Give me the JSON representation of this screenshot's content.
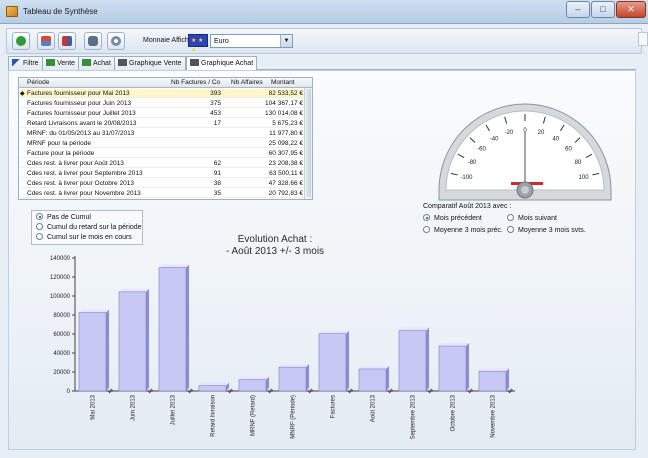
{
  "window": {
    "title": "Tableau de Synthèse",
    "min": "–",
    "max": "□",
    "close": "✕"
  },
  "toolbar": {
    "buttons": [
      "ok-icon",
      "calculator-icon",
      "export-icon",
      "print-icon",
      "tools-icon"
    ],
    "monnaie_label": "Monnaie Affichée",
    "currency_value": "Euro",
    "flag_stars": "★ ★ ★"
  },
  "tabs": [
    {
      "label": "Filtre",
      "icon": "filter-icon"
    },
    {
      "label": "Vente",
      "icon": "sales-icon"
    },
    {
      "label": "Achat",
      "icon": "purchase-icon"
    },
    {
      "label": "Graphique Vente",
      "icon": "chart-icon"
    },
    {
      "label": "Graphique Achat",
      "icon": "chart-icon",
      "active": true
    }
  ],
  "grid": {
    "headers": [
      "Période",
      "Nb Factures / Co",
      "Nb Affaires",
      "Montant"
    ],
    "rows": [
      {
        "periode": "Factures fournisseur pour Mai 2013",
        "nb": "393",
        "montant": "82 533,52 €",
        "selected": true
      },
      {
        "periode": "Factures fournisseur pour Juin 2013",
        "nb": "375",
        "montant": "104 367,17 €"
      },
      {
        "periode": "Factures fournisseur pour Juillet 2013",
        "nb": "453",
        "montant": "130 014,08 €"
      },
      {
        "periode": "Retard Livraisons avant le 20/08/2013",
        "nb": "17",
        "montant": "5 675,23 €"
      },
      {
        "periode": "MRNF: du 01/05/2013 au 31/07/2013",
        "nb": "",
        "montant": "11 977,80 €"
      },
      {
        "periode": "MRNF pour la période",
        "nb": "",
        "montant": "25 098,22 €"
      },
      {
        "periode": "Facture pour la période",
        "nb": "",
        "montant": "60 307,95 €"
      },
      {
        "periode": "Cdes rest. à livrer pour Août 2013",
        "nb": "62",
        "montant": "23 208,38 €"
      },
      {
        "periode": "Cdes rest. à livrer pour Septembre 2013",
        "nb": "91",
        "montant": "63 500,11 €"
      },
      {
        "periode": "Cdes rest. à livrer pour Octobre 2013",
        "nb": "38",
        "montant": "47 328,66 €"
      },
      {
        "periode": "Cdes rest. à livrer pour Novembre 2013",
        "nb": "35",
        "montant": "20 792,83 €"
      }
    ]
  },
  "gauge": {
    "ticks": [
      "-100",
      "-80",
      "-60",
      "-40",
      "-20",
      "0",
      "20",
      "40",
      "60",
      "80",
      "100"
    ],
    "needle_value": 0
  },
  "comparatif": {
    "label": "Comparatif Août 2013  avec :",
    "options": [
      {
        "label": "Mois précédent",
        "checked": true
      },
      {
        "label": "Mois suivant",
        "checked": false
      },
      {
        "label": "Moyenne 3 mois préc.",
        "checked": false
      },
      {
        "label": "Moyenne 3 mois svts.",
        "checked": false
      }
    ]
  },
  "cumul": {
    "options": [
      {
        "label": "Pas de Cumul",
        "checked": true
      },
      {
        "label": "Cumul du retard sur la période",
        "checked": false
      },
      {
        "label": "Cumul sur le mois en cours",
        "checked": false
      }
    ]
  },
  "chart_data": {
    "type": "bar",
    "title": "Evolution Achat :",
    "subtitle": "- Août 2013 +/- 3 mois",
    "categories": [
      "Mai 2013",
      "Juin 2013",
      "Juillet 2013",
      "Retard livraison",
      "MRNF (Retard)",
      "MNRF (Période)",
      "Factures",
      "Août 2013",
      "Septembre 2013",
      "Octobre 2013",
      "Novembre 2013"
    ],
    "values": [
      82533.52,
      104367.17,
      130014.08,
      5675.23,
      11977.8,
      25098.22,
      60307.95,
      23208.38,
      63500.11,
      47328.66,
      20792.83
    ],
    "yticks": [
      0,
      20000,
      40000,
      60000,
      80000,
      100000,
      120000,
      140000
    ],
    "ylim": [
      0,
      140000
    ],
    "bar_color": "#c8c8f4",
    "grid": false
  }
}
